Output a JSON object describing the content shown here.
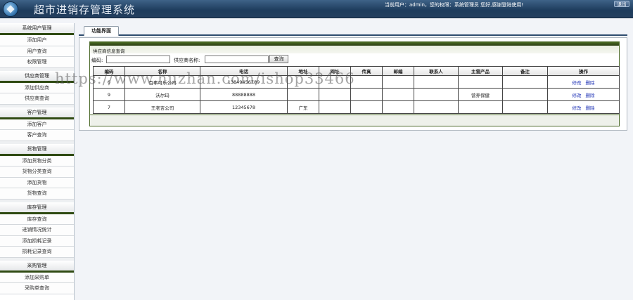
{
  "header": {
    "title": "超市进销存管理系统",
    "user_info": "当前用户：admin，您的权限：系统管理员 您好,感谢登陆使用!",
    "logout_label": "退出"
  },
  "sidebar": {
    "sections": [
      {
        "title": "系统用户管理",
        "items": [
          "添加用户",
          "用户查询",
          "权限管理"
        ]
      },
      {
        "title": "供应商管理",
        "items": [
          "添加供应商",
          "供应商查询"
        ]
      },
      {
        "title": "客户管理",
        "items": [
          "添加客户",
          "客户查询"
        ]
      },
      {
        "title": "货物管理",
        "items": [
          "添加货物分类",
          "货物分类查询",
          "添加货物",
          "货物查询"
        ]
      },
      {
        "title": "库存管理",
        "items": [
          "库存查询",
          "进销情况统计",
          "添加损耗记录",
          "损耗记录查询"
        ]
      },
      {
        "title": "采购管理",
        "items": [
          "添加采购单",
          "采购单查询"
        ]
      }
    ]
  },
  "tabs": [
    {
      "label": "功能界面"
    }
  ],
  "panel": {
    "title": "供应商信息查询",
    "search": {
      "id_label": "编码:",
      "name_label": "供应商名称:",
      "button_label": "查询"
    },
    "columns": [
      "编码",
      "名称",
      "电话",
      "地址",
      "网址",
      "传真",
      "邮编",
      "联系人",
      "主营产品",
      "备注",
      "操作"
    ],
    "rows": [
      {
        "cells": [
          "6",
          "百事可乐公司",
          "13849456789",
          "",
          "",
          "",
          "",
          "",
          "",
          ""
        ],
        "edit": "修改",
        "delete": "删除"
      },
      {
        "cells": [
          "9",
          "沃尔玛",
          "88888888",
          "",
          "",
          "",
          "",
          "",
          "营养保健",
          ""
        ],
        "edit": "修改",
        "delete": "删除"
      },
      {
        "cells": [
          "7",
          "王老吉公司",
          "12345678",
          "广东",
          "",
          "",
          "",
          "",
          "",
          ""
        ],
        "edit": "修改",
        "delete": "删除"
      }
    ]
  },
  "watermark": "https://www.huzhan.com/ishop33466"
}
